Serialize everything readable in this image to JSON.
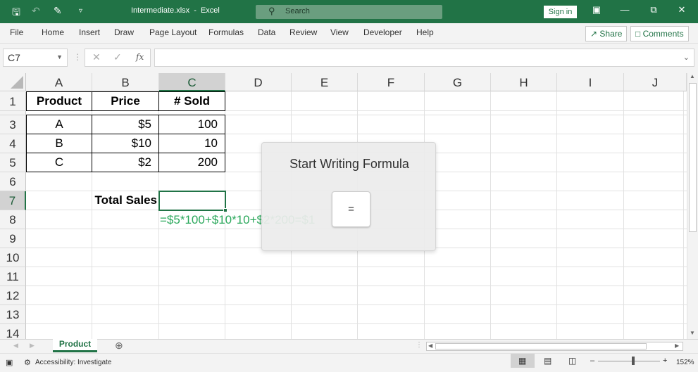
{
  "titlebar": {
    "filename": "Intermediate.xlsx",
    "separator": "-",
    "app": "Excel",
    "search_placeholder": "Search",
    "signin": "Sign in"
  },
  "ribbon": {
    "tabs": [
      "File",
      "Home",
      "Insert",
      "Draw",
      "Page Layout",
      "Formulas",
      "Data",
      "Review",
      "View",
      "Developer",
      "Help"
    ],
    "share": "Share",
    "comments": "Comments"
  },
  "formula_bar": {
    "name_box": "C7",
    "fx": "fx",
    "content": ""
  },
  "grid": {
    "columns": [
      "A",
      "B",
      "C",
      "D",
      "E",
      "F",
      "G",
      "H",
      "I",
      "J"
    ],
    "rows": [
      "1",
      "3",
      "4",
      "5",
      "6",
      "7",
      "8",
      "9",
      "10",
      "11",
      "12",
      "13",
      "14"
    ],
    "cells": {
      "A1": "Product",
      "B1": "Price",
      "C1": "# Sold",
      "A3": "A",
      "B3": "$5",
      "C3": "100",
      "A4": "B",
      "B4": "$10",
      "C4": "10",
      "A5": "C",
      "B5": "$2",
      "C5": "200",
      "B7": "Total Sales",
      "C8": "=$5*100+$10*10+$2*200=$1"
    },
    "selected_cell": "C7"
  },
  "dialog": {
    "title": "Start Writing Formula",
    "key": "="
  },
  "sheets": {
    "active": "Product"
  },
  "statusbar": {
    "accessibility": "Accessibility: Investigate",
    "zoom": "152%"
  },
  "colors": {
    "accent": "#217346",
    "formula_text": "#2aa85b"
  }
}
